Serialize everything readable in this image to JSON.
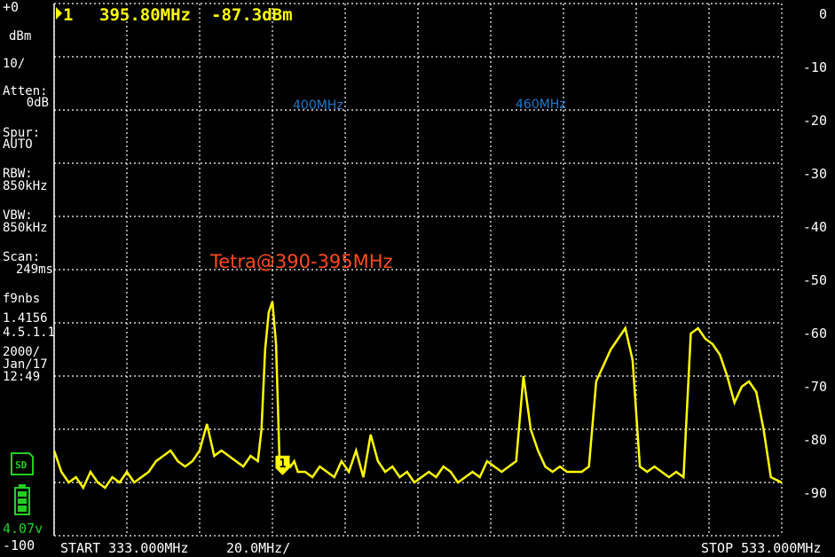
{
  "header": {
    "marker_label": "1",
    "marker_freq": "395.80MHz",
    "marker_level": "-87.3dBm"
  },
  "left_panel": {
    "ref_level": "+0",
    "ref_unit": "dBm",
    "scale": "10/",
    "atten_label": "Atten:",
    "atten_value": "0dB",
    "spur_label": "Spur:",
    "spur_value": "AUTO",
    "rbw_label": "RBW:",
    "rbw_value": "850kHz",
    "vbw_label": "VBW:",
    "vbw_value": "850kHz",
    "scan_label": "Scan:",
    "scan_value": "249ms",
    "device_name": "f9nbs",
    "fw_version": "1.4156",
    "hw_version": "4.5.1.1",
    "date_year": "2000/",
    "date_month_day": "Jan/17",
    "time": "12:49",
    "sd_icon": "sd-card-icon",
    "battery_icon": "battery-icon",
    "voltage": "4.07v",
    "bottom_level": "-100"
  },
  "footer": {
    "start": "START 333.000MHz",
    "per_div": "20.0MHz/",
    "stop": "STOP 533.000MHz"
  },
  "annotations": {
    "band_400": "400MHz",
    "band_460": "460MHz",
    "tetra": "Tetra@390-395MHz"
  },
  "colors": {
    "trace": "#ffff00",
    "grid": "#ffffff",
    "marker": "#ffff00",
    "band_text": "#1e78c8",
    "annotation": "#ff4a1c",
    "status_green": "#22d022"
  },
  "chart_data": {
    "type": "line",
    "xlim": [
      333.0,
      533.0
    ],
    "ylim": [
      -100,
      0
    ],
    "y_ticks": [
      "0",
      "-10",
      "-20",
      "-30",
      "-40",
      "-50",
      "-60",
      "-70",
      "-80",
      "-90"
    ],
    "series": [
      {
        "x": [
          333,
          335,
          337,
          339,
          341,
          343,
          345,
          347,
          349,
          351,
          353,
          355,
          357,
          359,
          361,
          363,
          365,
          367,
          369,
          371,
          373,
          375,
          377,
          379,
          381,
          383,
          385,
          387,
          389,
          390,
          391,
          392,
          393,
          394,
          395,
          396,
          397,
          398,
          399,
          400,
          402,
          404,
          406,
          408,
          410,
          412,
          414,
          416,
          418,
          420,
          422,
          424,
          426,
          428,
          430,
          432,
          434,
          436,
          438,
          440,
          442,
          444,
          446,
          448,
          450,
          452,
          454,
          456,
          458,
          460,
          462,
          464,
          466,
          468,
          470,
          472,
          474,
          476,
          478,
          480,
          482,
          484,
          486,
          488,
          490,
          492,
          494,
          496,
          498,
          500,
          502,
          504,
          506,
          508,
          510,
          512,
          514,
          516,
          518,
          520,
          522,
          524,
          526,
          528,
          530,
          533
        ],
        "y": [
          -84,
          -88,
          -90,
          -89,
          -91,
          -88,
          -90,
          -91,
          -89,
          -90,
          -88,
          -90,
          -89,
          -88,
          -86,
          -85,
          -84,
          -86,
          -87,
          -86,
          -84,
          -79,
          -85,
          -84,
          -85,
          -86,
          -87,
          -85,
          -86,
          -80,
          -65,
          -58,
          -56,
          -64,
          -87,
          -86,
          -86,
          -87,
          -86,
          -88,
          -88,
          -89,
          -87,
          -88,
          -89,
          -86,
          -88,
          -84,
          -89,
          -81,
          -86,
          -88,
          -87,
          -89,
          -88,
          -90,
          -89,
          -88,
          -89,
          -87,
          -88,
          -90,
          -89,
          -88,
          -89,
          -86,
          -87,
          -88,
          -87,
          -86,
          -70,
          -80,
          -84,
          -87,
          -88,
          -87,
          -88,
          -88,
          -88,
          -87,
          -71,
          -68,
          -65,
          -63,
          -61,
          -67,
          -87,
          -88,
          -87,
          -88,
          -89,
          -88,
          -89,
          -62,
          -61,
          -63,
          -64,
          -66,
          -70,
          -75,
          -72,
          -71,
          -73,
          -80,
          -89,
          -90
        ]
      }
    ],
    "markers": [
      {
        "label": "1",
        "x": 395.8,
        "y": -87.3
      }
    ]
  }
}
